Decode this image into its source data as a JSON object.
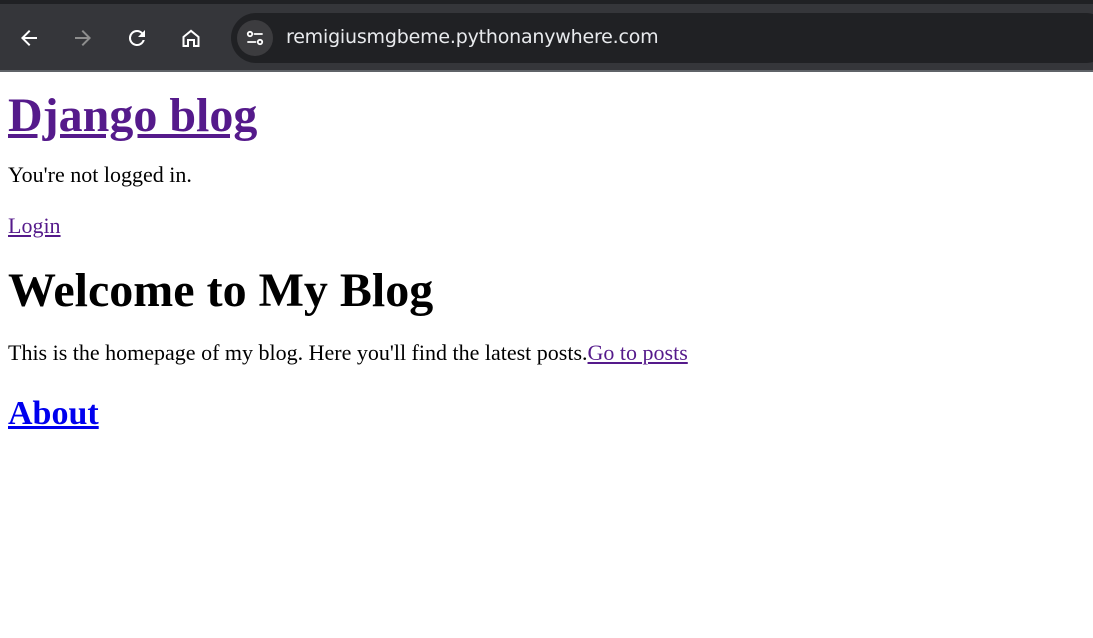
{
  "browser": {
    "url": "remigiusmgbeme.pythonanywhere.com",
    "icons": [
      "back-arrow-icon",
      "forward-arrow-icon",
      "reload-icon",
      "home-icon",
      "site-info-icon"
    ]
  },
  "page": {
    "site_title": "Django blog",
    "login_status": "You're not logged in.",
    "login_link": "Login",
    "heading": "Welcome to My Blog",
    "intro_text": "This is the homepage of my blog. Here you'll find the latest posts.",
    "posts_link": "Go to posts",
    "about_link": "About"
  },
  "colors": {
    "visited_link": "#551a8b",
    "unvisited_link": "#0000ee",
    "toolbar_bg": "#35363a",
    "omnibox_bg": "#202124"
  }
}
